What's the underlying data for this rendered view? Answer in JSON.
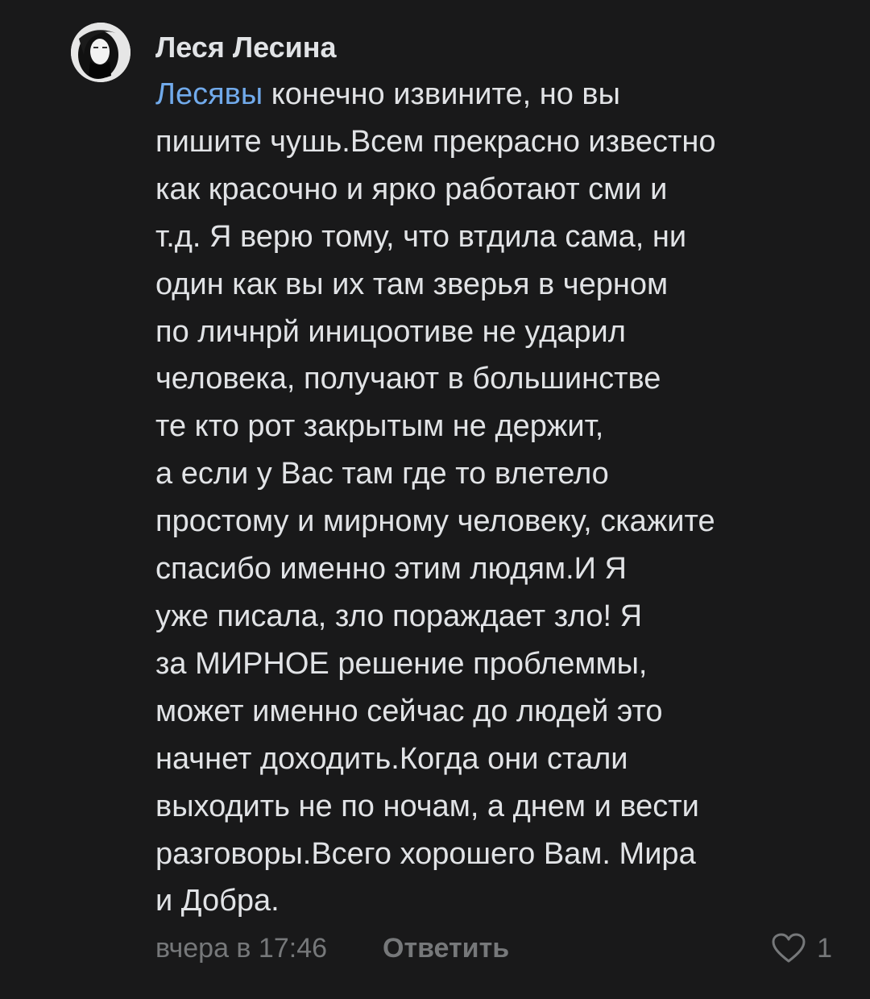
{
  "comment": {
    "author": "Леся Лесина",
    "mention": "Лесявы",
    "lines": [
      " конечно извините, но вы",
      "пишите чушь.Всем прекрасно известно",
      "как красочно и ярко работают сми и",
      "т.д. Я верю тому, что втдила сама, ни",
      "один как вы их там зверья в черном",
      "по личнрй иницоотиве не ударил",
      "человека, получают в большинстве",
      "те кто рот закрытым не держит,",
      "а если у Вас там где то влетело",
      "простому и мирному человеку, скажите",
      "спасибо именно этим людям.И Я",
      "уже писала, зло пораждает зло! Я",
      "за МИРНОЕ решение проблеммы,",
      "может именно сейчас до людей это",
      "начнет доходить.Когда они стали",
      "выходить не по ночам, а днем и вести",
      "разговоры.Всего хорошего Вам. Мира",
      "и Добра."
    ],
    "timestamp": "вчера в 17:46",
    "reply_label": "Ответить",
    "like_icon": "heart-outline-icon",
    "like_count": "1"
  },
  "colors": {
    "background": "#19191a",
    "text": "#e1e3e6",
    "mention": "#71aaeb",
    "secondary": "#76787a"
  }
}
